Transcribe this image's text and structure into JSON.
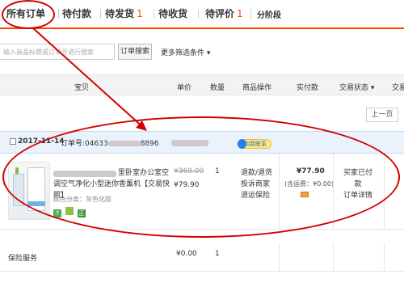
{
  "tabs": [
    {
      "label": "所有订单",
      "count": ""
    },
    {
      "label": "待付款",
      "count": ""
    },
    {
      "label": "待发货",
      "count": "1"
    },
    {
      "label": "待收货",
      "count": ""
    },
    {
      "label": "待评价",
      "count": "1"
    },
    {
      "label": "分阶段",
      "count": ""
    }
  ],
  "search": {
    "placeholder": "输入商品标题或订单号进行搜索",
    "button_label": "订单搜索",
    "more_label": "更多筛选条件"
  },
  "table_headers": [
    "宝贝",
    "单价",
    "数量",
    "商品操作",
    "实付款",
    "交易状态",
    "交易"
  ],
  "pager": {
    "prev_label": "上一页"
  },
  "order": {
    "date": "2017-11-14",
    "order_no_label": "订单号:",
    "order_no_visible": "04633",
    "order_no_tail": "8896",
    "contact_label": "和我联系",
    "item": {
      "title": "里卧室办公室空调空气净化小型迷你香薰机【交易快照】",
      "spec": "颜色分类：灰色化版",
      "badges": [
        "7",
        "",
        "正"
      ],
      "original_price": "¥369.00",
      "price": "¥79.90",
      "quantity": "1",
      "ops": [
        "退款/退货",
        "投诉商家",
        "退运保险"
      ],
      "paid": "¥77.90",
      "shipping": "(含运费：¥0.00)",
      "status": [
        "买家已付款",
        "订单详情"
      ]
    }
  },
  "insurance": {
    "label": "保险服务",
    "price": "¥0.00",
    "quantity": "1"
  },
  "colors": {
    "accent": "#ff4400",
    "annotation": "#d10000"
  }
}
